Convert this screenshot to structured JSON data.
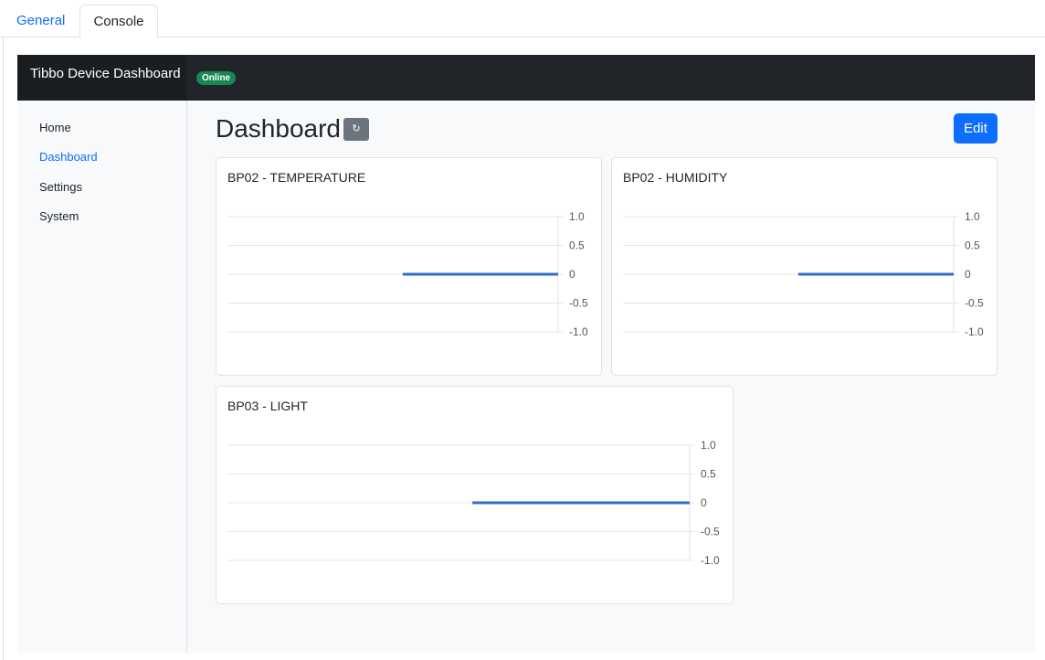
{
  "tabs": {
    "general": "General",
    "console": "Console"
  },
  "navbar": {
    "brand": "Tibbo Device Dashboard",
    "status_badge": "Online"
  },
  "sidebar": {
    "items": [
      {
        "label": "Home"
      },
      {
        "label": "Dashboard"
      },
      {
        "label": "Settings"
      },
      {
        "label": "System"
      }
    ]
  },
  "main": {
    "title": "Dashboard",
    "refresh_icon": "refresh-icon",
    "edit_label": "Edit"
  },
  "colors": {
    "accent": "#0d6efd",
    "online": "#198754",
    "line": "#2d6fc5",
    "navbar": "#212529"
  },
  "chart_data": [
    {
      "type": "line",
      "title": "BP02 - TEMPERATURE",
      "yticks": [
        "1.0",
        "0.5",
        "0",
        "-0.5",
        "-1.0"
      ],
      "ylim": [
        -1,
        1
      ],
      "xlim": [
        0,
        1
      ],
      "series": [
        {
          "x": [
            0.53,
            1.0
          ],
          "values": [
            0,
            0
          ]
        }
      ],
      "grid": true
    },
    {
      "type": "line",
      "title": "BP02 - HUMIDITY",
      "yticks": [
        "1.0",
        "0.5",
        "0",
        "-0.5",
        "-1.0"
      ],
      "ylim": [
        -1,
        1
      ],
      "xlim": [
        0,
        1
      ],
      "series": [
        {
          "x": [
            0.53,
            1.0
          ],
          "values": [
            0,
            0
          ]
        }
      ],
      "grid": true
    },
    {
      "type": "line",
      "title": "BP03 - LIGHT",
      "yticks": [
        "1.0",
        "0.5",
        "0",
        "-0.5",
        "-1.0"
      ],
      "ylim": [
        -1,
        1
      ],
      "xlim": [
        0,
        1
      ],
      "series": [
        {
          "x": [
            0.53,
            1.0
          ],
          "values": [
            0,
            0
          ]
        }
      ],
      "grid": true
    }
  ]
}
